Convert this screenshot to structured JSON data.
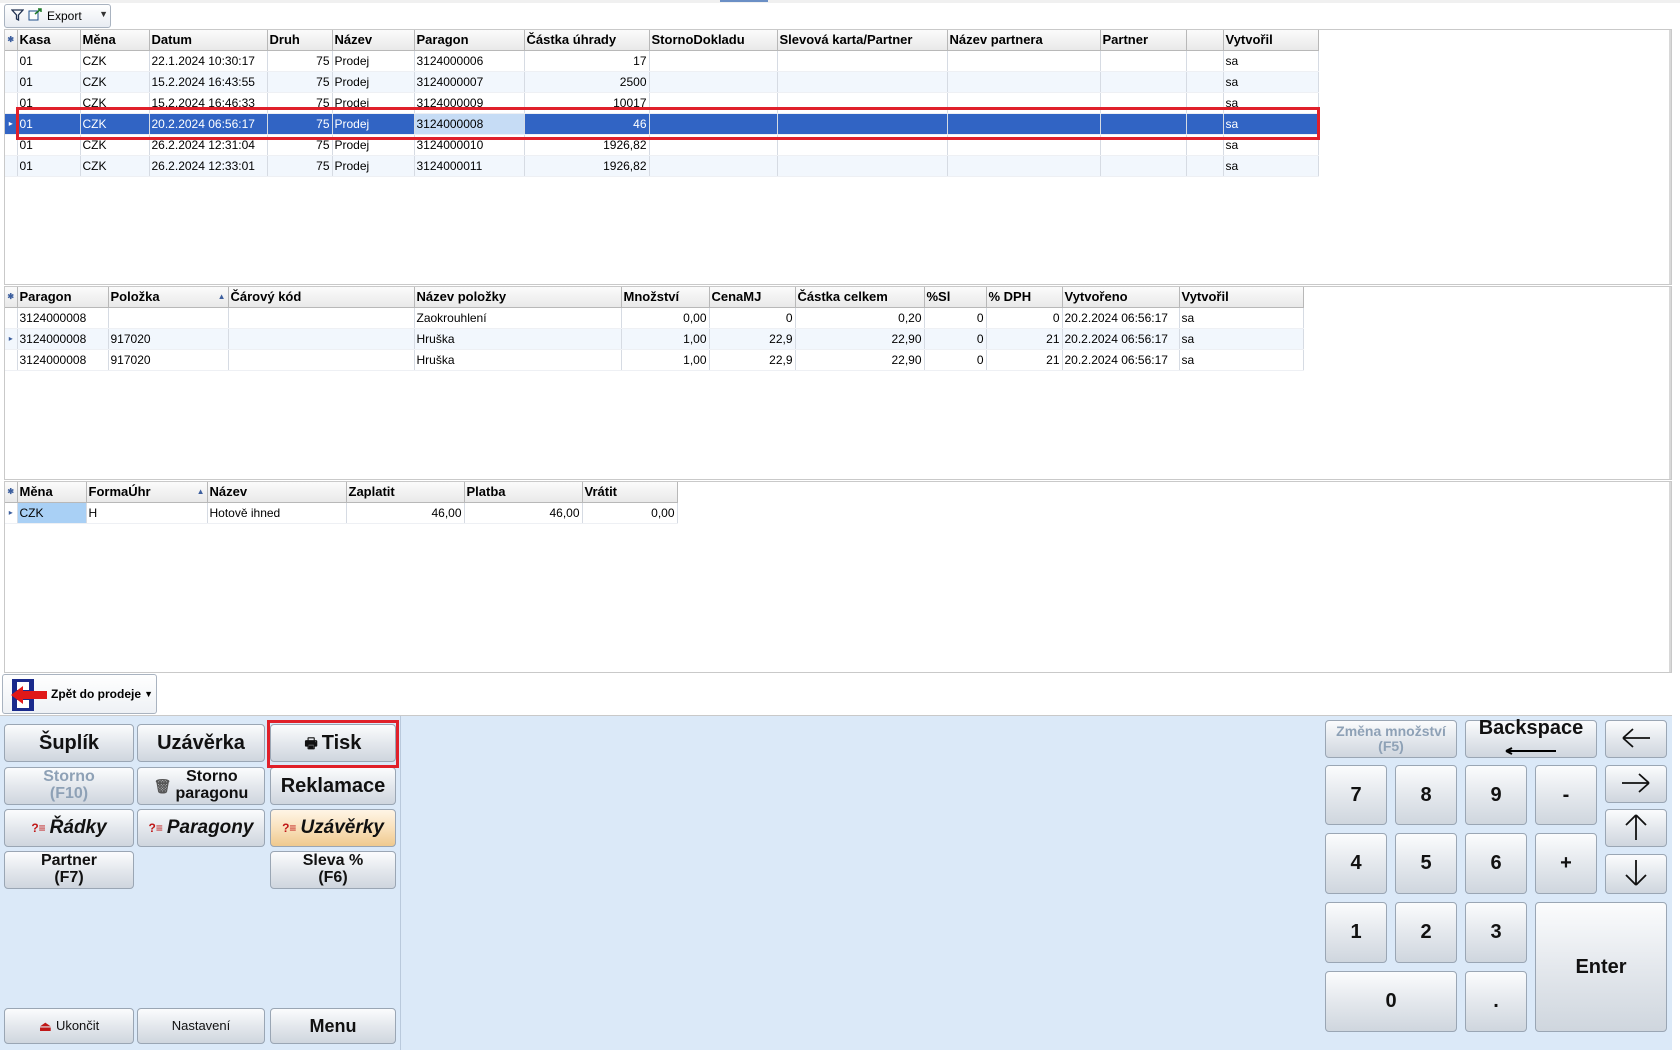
{
  "toolbar": {
    "export_label": "Export"
  },
  "grid1": {
    "columns": [
      "Kasa",
      "Měna",
      "Datum",
      "Druh",
      "Název",
      "Paragon",
      "Částka úhrady",
      "StornoDokladu",
      "Slevová karta/Partner",
      "Název partnera",
      "Partner",
      "",
      "Vytvořil"
    ],
    "rows": [
      [
        "01",
        "CZK",
        "22.1.2024 10:30:17",
        "75",
        "Prodej",
        "3124000006",
        "17",
        "",
        "",
        "",
        "",
        "",
        "sa"
      ],
      [
        "01",
        "CZK",
        "15.2.2024 16:43:55",
        "75",
        "Prodej",
        "3124000007",
        "2500",
        "",
        "",
        "",
        "",
        "",
        "sa"
      ],
      [
        "01",
        "CZK",
        "15.2.2024 16:46:33",
        "75",
        "Prodej",
        "3124000009",
        "10017",
        "",
        "",
        "",
        "",
        "",
        "sa"
      ],
      [
        "01",
        "CZK",
        "20.2.2024 06:56:17",
        "75",
        "Prodej",
        "3124000008",
        "46",
        "",
        "",
        "",
        "",
        "",
        "sa"
      ],
      [
        "01",
        "CZK",
        "26.2.2024 12:31:04",
        "75",
        "Prodej",
        "3124000010",
        "1926,82",
        "",
        "",
        "",
        "",
        "",
        "sa"
      ],
      [
        "01",
        "CZK",
        "26.2.2024 12:33:01",
        "75",
        "Prodej",
        "3124000011",
        "1926,82",
        "",
        "",
        "",
        "",
        "",
        "sa"
      ]
    ],
    "selected_row": 3
  },
  "grid2": {
    "columns": [
      "Paragon",
      "Položka",
      "Čárový kód",
      "Název položky",
      "Množství",
      "CenaMJ",
      "Částka celkem",
      "%Sl",
      "% DPH",
      "Vytvořeno",
      "Vytvořil"
    ],
    "rows": [
      [
        "3124000008",
        "",
        "",
        "Zaokrouhlení",
        "0,00",
        "0",
        "0,20",
        "0",
        "0",
        "20.2.2024 06:56:17",
        "sa"
      ],
      [
        "3124000008",
        "917020",
        "",
        "Hruška",
        "1,00",
        "22,9",
        "22,90",
        "0",
        "21",
        "20.2.2024 06:56:17",
        "sa"
      ],
      [
        "3124000008",
        "917020",
        "",
        "Hruška",
        "1,00",
        "22,9",
        "22,90",
        "0",
        "21",
        "20.2.2024 06:56:17",
        "sa"
      ]
    ]
  },
  "grid3": {
    "columns": [
      "Měna",
      "FormaÚhr",
      "Název",
      "Zaplatit",
      "Platba",
      "Vrátit"
    ],
    "rows": [
      [
        "CZK",
        "H",
        "Hotově ihned",
        "46,00",
        "46,00",
        "0,00"
      ]
    ]
  },
  "back_button": {
    "label": "Zpět do prodeje"
  },
  "buttons": {
    "suplik": "Šuplík",
    "uzaverka": "Uzávěrka",
    "tisk": "Tisk",
    "storno_l1": "Storno",
    "storno_l2": "(F10)",
    "storno_paragonu_l1": "Storno",
    "storno_paragonu_l2": "paragonu",
    "reklamace": "Reklamace",
    "radky": "Řádky",
    "paragony": "Paragony",
    "uzaverky": "Uzávěrky",
    "partner_l1": "Partner",
    "partner_l2": "(F7)",
    "sleva_l1": "Sleva %",
    "sleva_l2": "(F6)",
    "ukoncit": "Ukončit",
    "nastaveni": "Nastavení",
    "menu": "Menu"
  },
  "keypad": {
    "zmena_l1": "Změna množství",
    "zmena_l2": "(F5)",
    "backspace": "Backspace",
    "k7": "7",
    "k8": "8",
    "k9": "9",
    "minus": "-",
    "k4": "4",
    "k5": "5",
    "k6": "6",
    "plus": "+",
    "k1": "1",
    "k2": "2",
    "k3": "3",
    "k0": "0",
    "dot": ".",
    "enter": "Enter"
  }
}
